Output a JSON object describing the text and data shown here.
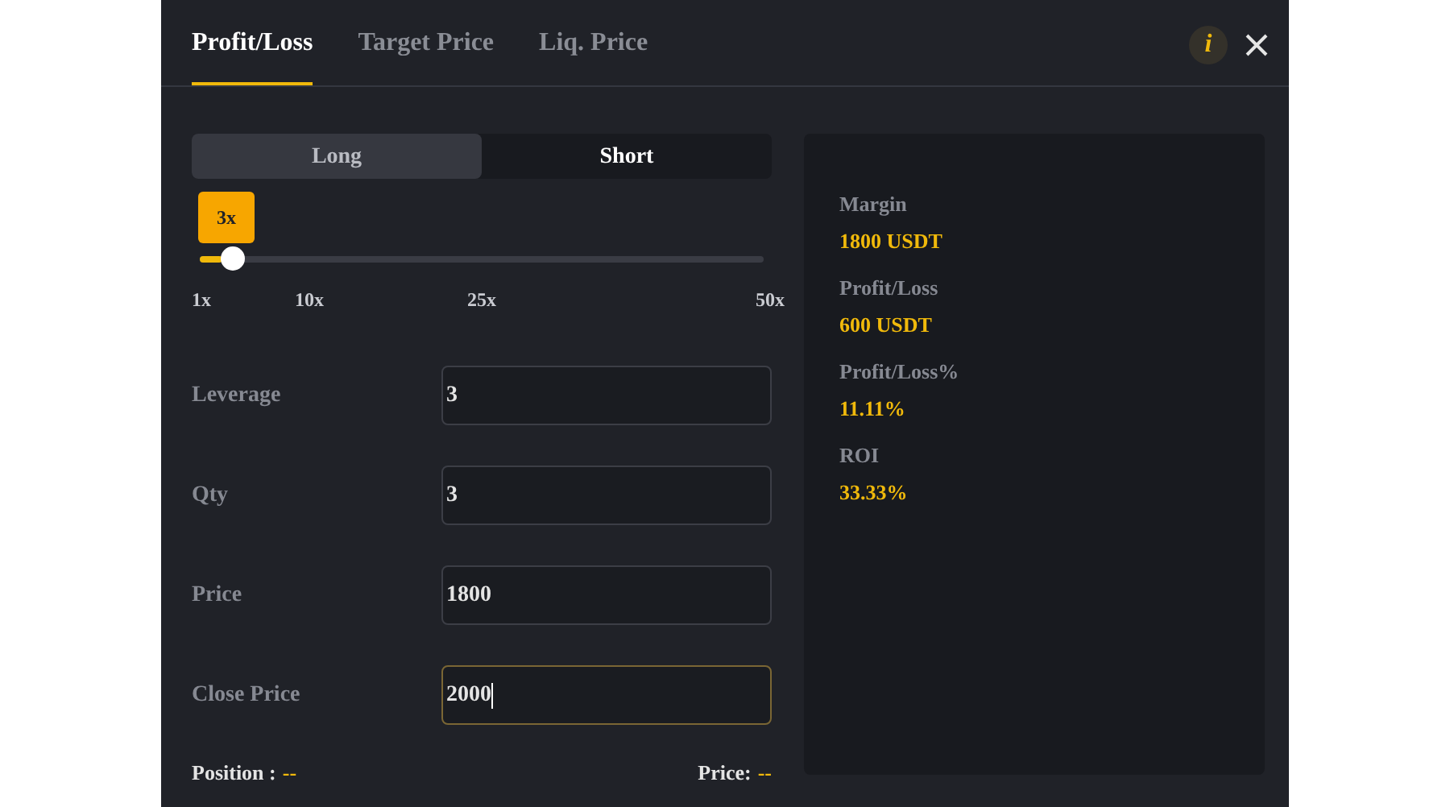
{
  "tabs": [
    {
      "label": "Profit/Loss",
      "selected": true
    },
    {
      "label": "Target Price",
      "selected": false
    },
    {
      "label": "Liq. Price",
      "selected": false
    }
  ],
  "header_buttons": {
    "info": "i"
  },
  "side_toggle": [
    {
      "label": "Long",
      "selected": true
    },
    {
      "label": "Short",
      "selected": false
    }
  ],
  "leverage_slider": {
    "badge": "3x",
    "level": 0.04,
    "ticks": [
      "1x",
      "10x",
      "25x",
      "50x"
    ]
  },
  "fields": [
    {
      "label": "Leverage",
      "value": "3",
      "focused": false
    },
    {
      "label": "Qty",
      "value": "3",
      "focused": false
    },
    {
      "label": "Price",
      "value": "1800",
      "focused": false
    },
    {
      "label": "Close Price",
      "value": "2000",
      "focused": true
    }
  ],
  "footer": {
    "position_label": "Position :",
    "position_value": "--",
    "price_label": "Price:",
    "price_value": "--"
  },
  "results": [
    {
      "label": "Margin",
      "value": "1800 USDT"
    },
    {
      "label": "Profit/Loss",
      "value": "600 USDT"
    },
    {
      "label": "Profit/Loss%",
      "value": "11.11%"
    },
    {
      "label": "ROI",
      "value": "33.33%"
    }
  ]
}
